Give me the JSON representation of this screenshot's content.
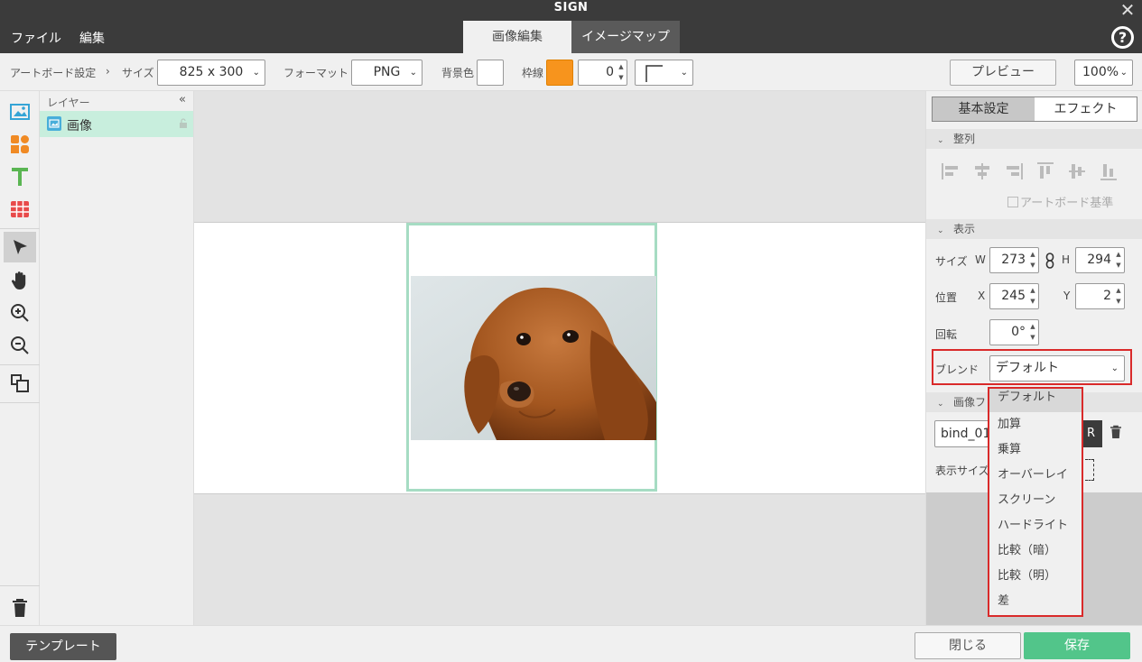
{
  "window": {
    "title": "SIGN",
    "close_icon": "close-icon"
  },
  "menu": {
    "items": [
      "ファイル",
      "編集"
    ]
  },
  "tabs": [
    {
      "label": "画像編集",
      "active": true
    },
    {
      "label": "イメージマップ",
      "active": false
    }
  ],
  "help": {
    "glyph": "?"
  },
  "toolbar": {
    "artboard_label": "アートボード設定",
    "chevron": "›",
    "size_label": "サイズ",
    "size_value": "825 x 300",
    "format_label": "フォーマット",
    "format_value": "PNG",
    "bg_label": "背景色",
    "bg_color": "#ffffff",
    "border_label": "枠線",
    "border_color": "#f7941d",
    "border_width": "0",
    "preview_label": "プレビュー",
    "zoom_value": "100%"
  },
  "layers": {
    "title": "レイヤー",
    "collapse": "«",
    "items": [
      {
        "name": "画像"
      }
    ]
  },
  "right_panel": {
    "tab_basic": "基本設定",
    "tab_effect": "エフェクト",
    "align_section": "整列",
    "artboard_base": "アートボード基準",
    "display_section": "表示",
    "size_label": "サイズ",
    "w_label": "W",
    "h_label": "H",
    "w_value": "273",
    "h_value": "294",
    "position_label": "位置",
    "x_label": "X",
    "y_label": "Y",
    "x_value": "245",
    "y_value": "2",
    "rotate_label": "回転",
    "rotate_value": "0°",
    "blend_label": "ブレンド",
    "blend_value": "デフォルト",
    "image_section": "画像フ",
    "file_value": "bind_01",
    "file_btn": "R",
    "display_size_label": "表示サイズ"
  },
  "blend_options": [
    "デフォルト",
    "加算",
    "乗算",
    "オーバーレイ",
    "スクリーン",
    "ハードライト",
    "比較（暗）",
    "比較（明）",
    "差"
  ],
  "bottom": {
    "template_label": "テンプレート",
    "close_label": "閉じる",
    "save_label": "保存"
  },
  "colors": {
    "accent_green": "#52c58a",
    "highlight_red": "#d92a2a",
    "dark": "#3b3b3b"
  }
}
